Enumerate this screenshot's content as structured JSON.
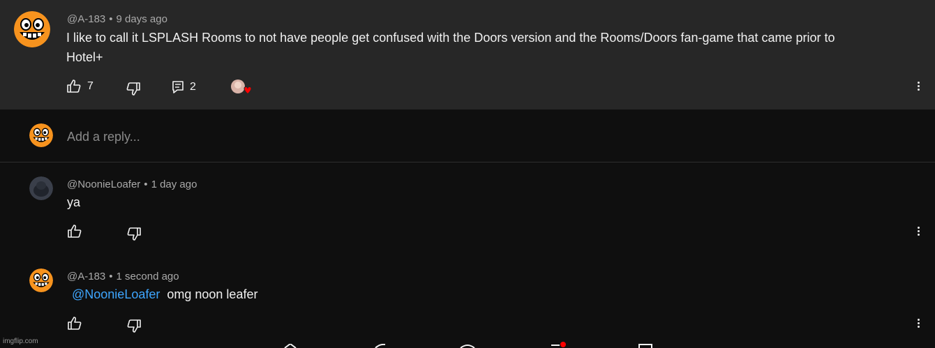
{
  "top_comment": {
    "author": "@A-183",
    "time": "9 days ago",
    "text_line1": "I like to call it LSPLASH Rooms to not have people get confused with the Doors version and the Rooms/Doors fan-game that came prior to",
    "text_line2": "Hotel+",
    "likes": "7",
    "replies": "2",
    "creator_heart": true,
    "like_icon": "thumbs-up-icon",
    "dislike_icon": "thumbs-down-icon",
    "reply_icon": "reply-icon",
    "more_icon": "more-vertical-icon"
  },
  "reply_box": {
    "placeholder": "Add a reply..."
  },
  "replies": [
    {
      "author": "@NoonieLoafer",
      "time": "1 day ago",
      "text": "ya"
    },
    {
      "author": "@A-183",
      "time": "1 second ago",
      "mention": "@NoonieLoafer",
      "text": "omg noon leafer"
    }
  ],
  "watermark": "imgflip.com",
  "colors": {
    "top_comment_bg": "#272727",
    "page_bg": "#0f0f0f",
    "meta_text": "#aaaaaa",
    "mention": "#3ea6ff",
    "heart": "#ff0000",
    "avatar_orange": "#f7931e"
  }
}
